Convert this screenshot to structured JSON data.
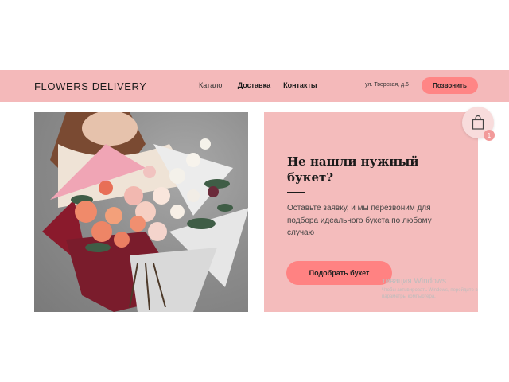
{
  "header": {
    "logo": "FLOWERS DELIVERY",
    "nav": [
      "Каталог",
      "Доставка",
      "Контакты"
    ],
    "address": "ул. Тверская, д.6",
    "call_button": "Позвонить"
  },
  "promo": {
    "title": "Не нашли нужный букет?",
    "text": "Оставьте заявку, и мы перезвоним для подбора идеального букета по любому случаю",
    "button": "Подобрать букет"
  },
  "cart": {
    "count": "1",
    "icon": "shopping-bag-icon"
  },
  "watermark": {
    "title": "тивация Windows",
    "text": "Чтобы активировать Windows, перейдите в параметры компьютера."
  },
  "colors": {
    "header_bg": "#f4b9ba",
    "panel_bg": "#f4bcbc",
    "accent_button": "#ff8585"
  }
}
